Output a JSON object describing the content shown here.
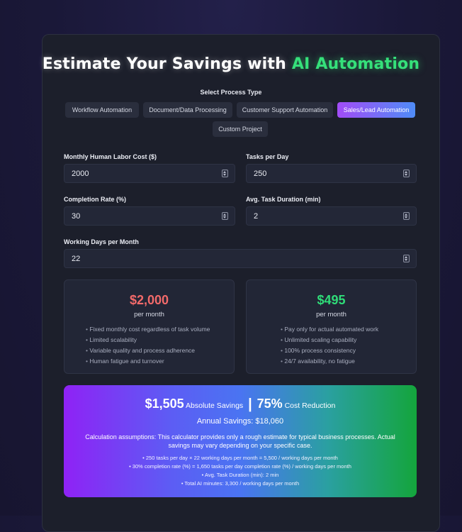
{
  "header": {
    "title_prefix": "Estimate Your Savings with",
    "title_accent": "AI Automation"
  },
  "process_type": {
    "label": "Select Process Type",
    "tabs": [
      {
        "label": "Workflow Automation",
        "active": false
      },
      {
        "label": "Document/Data Processing",
        "active": false
      },
      {
        "label": "Customer Support Automation",
        "active": false
      },
      {
        "label": "Sales/Lead Automation",
        "active": true
      },
      {
        "label": "Custom Project",
        "active": false
      }
    ]
  },
  "inputs": {
    "monthly_cost": {
      "label": "Monthly Human Labor Cost ($)",
      "value": "2000"
    },
    "tasks_per_day": {
      "label": "Tasks per Day",
      "value": "250"
    },
    "completion_rate": {
      "label": "Completion Rate (%)",
      "value": "30"
    },
    "task_duration": {
      "label": "Avg. Task Duration (min)",
      "value": "2"
    },
    "working_days": {
      "label": "Working Days per Month",
      "value": "22"
    }
  },
  "human": {
    "price": "$2,000",
    "period": "per month",
    "color": "#f26a6a",
    "points": [
      "Fixed monthly cost regardless of task volume",
      "Limited scalability",
      "Variable quality and process adherence",
      "Human fatigue and turnover"
    ]
  },
  "ai": {
    "price": "$495",
    "period": "per month",
    "color": "#2fdc78",
    "points": [
      "Pay only for actual automated work",
      "Unlimited scaling capability",
      "100% process consistency",
      "24/7 availability, no fatigue"
    ]
  },
  "result": {
    "savings_value": "$1,505",
    "savings_label": "Absolute Savings",
    "divider": "|",
    "reduction_value": "75%",
    "reduction_label": "Cost Reduction",
    "annual": "Annual Savings: $18,060",
    "assumptions": "Calculation assumptions: This calculator provides only a rough estimate for typical business processes. Actual savings may vary depending on your specific case.",
    "notes": [
      "• 250 tasks per day × 22 working days per month = 5,500 / working days per month",
      "• 30% completion rate (%) = 1,650 tasks per day completion rate (%) / working days per month",
      "• Avg. Task Duration (min): 2 min",
      "• Total AI minutes: 3,300 / working days per month"
    ]
  }
}
